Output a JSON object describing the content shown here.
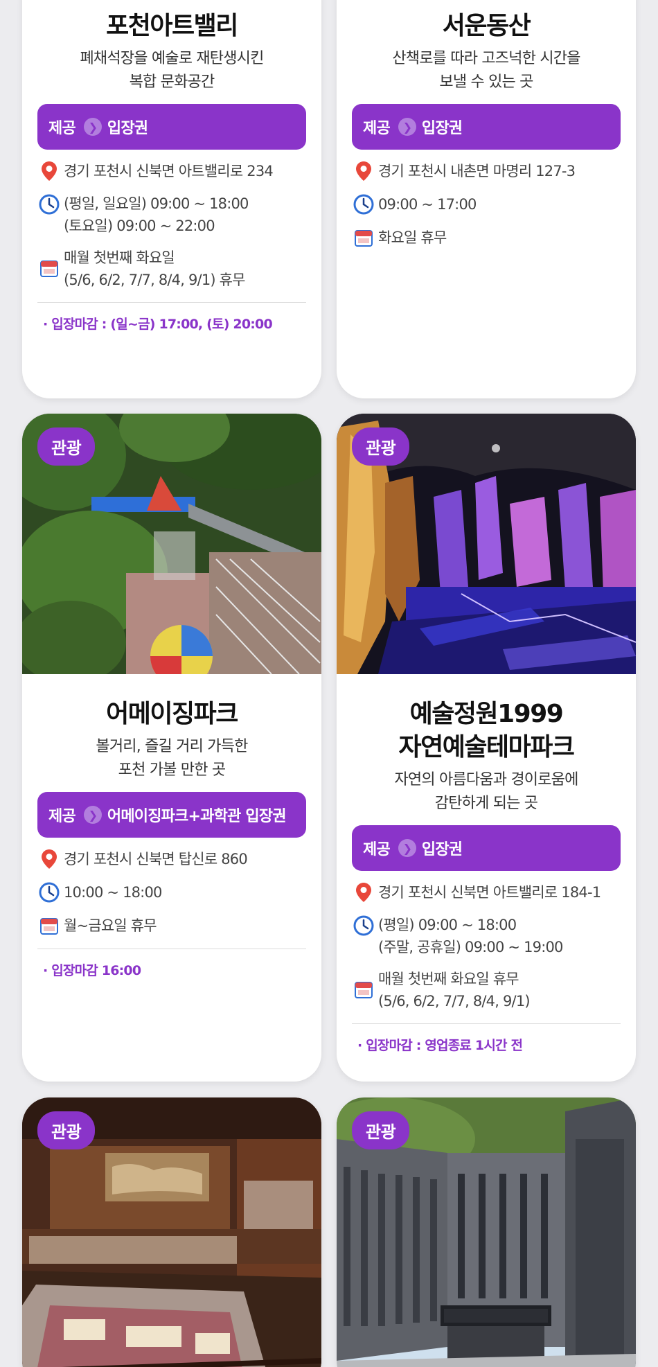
{
  "cards": [
    {
      "title": "포천아트밸리",
      "desc1": "폐채석장을 예술로 재탄생시킨",
      "desc2": "복합 문화공간",
      "offer_label": "제공",
      "offer_value": "입장권",
      "address": "경기 포천시 신북면 아트밸리로 234",
      "hours1": "(평일, 일요일) 09:00 ~ 18:00",
      "hours2": "(토요일) 09:00 ~ 22:00",
      "closed1": "매월 첫번째 화요일",
      "closed2": "(5/6, 6/2, 7/7, 8/4, 9/1) 휴무",
      "note": "· 입장마감 : (일~금) 17:00, (토) 20:00"
    },
    {
      "title": "서운동산",
      "desc1": "산책로를 따라 고즈넉한 시간을",
      "desc2": "보낼 수 있는 곳",
      "offer_label": "제공",
      "offer_value": "입장권",
      "address": "경기 포천시 내촌면 마명리 127-3",
      "hours1": "09:00 ~ 17:00",
      "closed1": "화요일 휴무"
    },
    {
      "badge": "관광",
      "title": "어메이징파크",
      "desc1": "볼거리, 즐길 거리 가득한",
      "desc2": "포천 가볼 만한 곳",
      "offer_label": "제공",
      "offer_value": "어메이징파크+과학관 입장권",
      "address": "경기 포천시 신북면 탑신로 860",
      "hours1": "10:00 ~ 18:00",
      "closed1": "월~금요일 휴무",
      "note": "· 입장마감 16:00"
    },
    {
      "badge": "관광",
      "title1": "예술정원1999",
      "title2": "자연예술테마파크",
      "desc1": "자연의 아름다움과 경이로움에",
      "desc2": "감탄하게 되는 곳",
      "offer_label": "제공",
      "offer_value": "입장권",
      "address": "경기 포천시 신북면 아트밸리로 184-1",
      "hours1": "(평일) 09:00 ~ 18:00",
      "hours2": "(주말, 공휴일) 09:00 ~ 19:00",
      "closed1": "매월 첫번째 화요일 휴무",
      "closed2": "(5/6, 6/2, 7/7, 8/4, 9/1)",
      "note": "· 입장마감 : 영업종료 1시간 전"
    },
    {
      "badge": "관광"
    },
    {
      "badge": "관광"
    }
  ],
  "colors": {
    "accent": "#8a34c9",
    "pin": "#e8473a",
    "clock": "#2f6fd6",
    "calendar": "#e24b4b"
  }
}
